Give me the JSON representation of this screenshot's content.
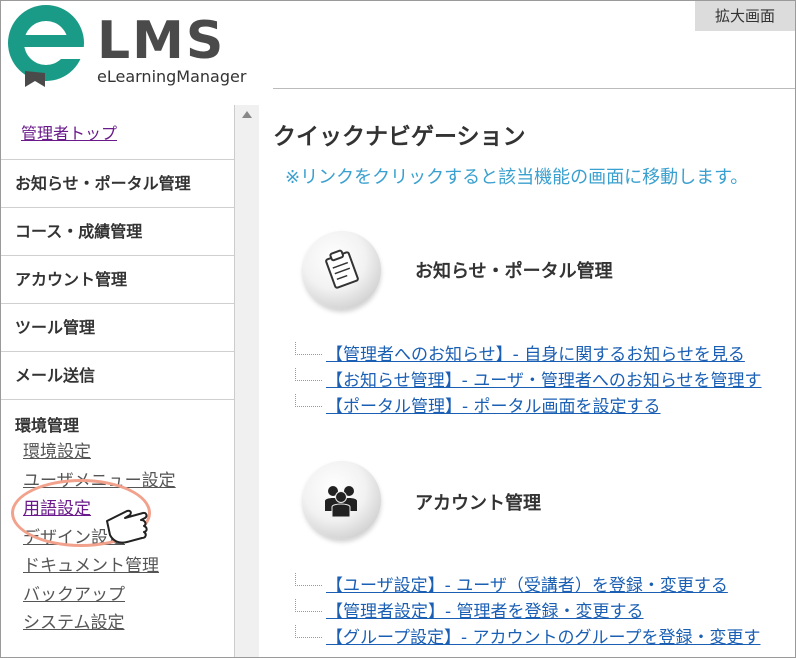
{
  "header": {
    "logo_text": "LMS",
    "logo_subtext": "eLearningManager",
    "zoom_badge": "拡大画面"
  },
  "sidebar": {
    "top_link": "管理者トップ",
    "items": [
      {
        "label": "お知らせ・ポータル管理"
      },
      {
        "label": "コース・成績管理"
      },
      {
        "label": "アカウント管理"
      },
      {
        "label": "ツール管理"
      },
      {
        "label": "メール送信"
      }
    ],
    "group": {
      "title": "環境管理",
      "links": [
        {
          "label": "環境設定"
        },
        {
          "label": "ユーザメニュー設定"
        },
        {
          "label": "用語設定"
        },
        {
          "label": "デザイン設定"
        },
        {
          "label": "ドキュメント管理"
        },
        {
          "label": "バックアップ"
        },
        {
          "label": "システム設定"
        }
      ]
    }
  },
  "main": {
    "title": "クイックナビゲーション",
    "note": "※リンクをクリックすると該当機能の画面に移動します。",
    "sections": [
      {
        "title": "お知らせ・ポータル管理",
        "icon": "clipboard-icon",
        "links": [
          "【管理者へのお知らせ】- 自身に関するお知らせを見る",
          "【お知らせ管理】- ユーザ・管理者へのお知らせを管理す",
          "【ポータル管理】- ポータル画面を設定する"
        ]
      },
      {
        "title": "アカウント管理",
        "icon": "users-icon",
        "links": [
          "【ユーザ設定】- ユーザ（受講者）を登録・変更する",
          "【管理者設定】- 管理者を登録・変更する",
          "【グループ設定】- アカウントのグループを登録・変更す"
        ]
      }
    ]
  },
  "colors": {
    "logo_teal": "#1a9b87",
    "logo_gray": "#4a4a4a",
    "note_blue": "#3aa0cf",
    "link_blue": "#1a5fb4",
    "visited_purple": "#6a1a8a",
    "highlight": "#f2a28c"
  }
}
